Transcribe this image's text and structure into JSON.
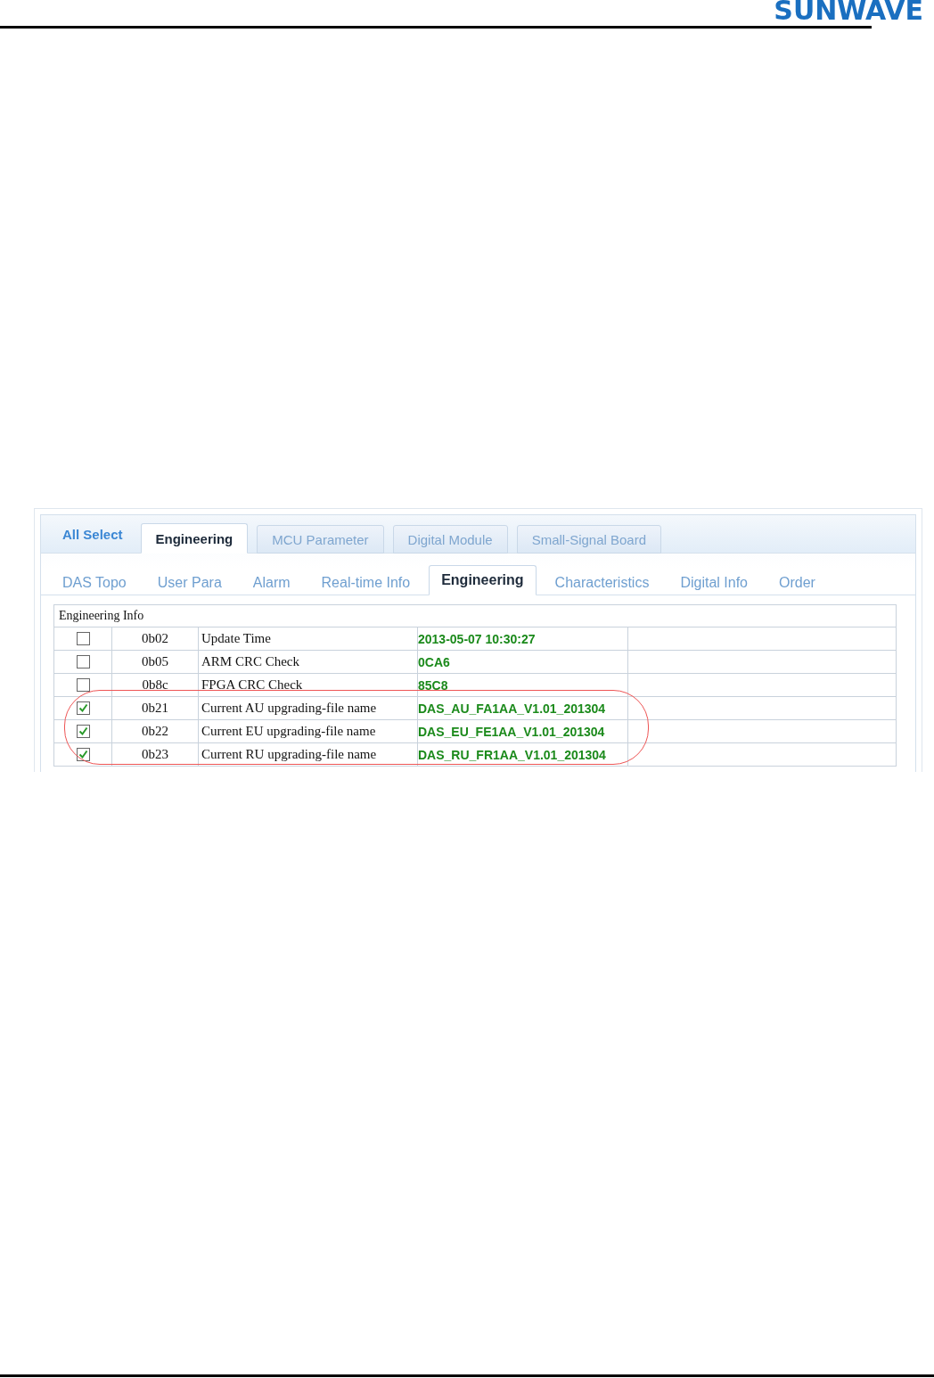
{
  "header": {
    "logo": "SUNWAVE"
  },
  "screenshot": {
    "all_select": "All Select",
    "top_tabs": [
      {
        "label": "Engineering",
        "selected": true
      },
      {
        "label": "MCU Parameter",
        "selected": false
      },
      {
        "label": "Digital Module",
        "selected": false
      },
      {
        "label": "Small-Signal Board",
        "selected": false
      }
    ],
    "sub_tabs": [
      {
        "label": "DAS Topo",
        "selected": false
      },
      {
        "label": "User Para",
        "selected": false
      },
      {
        "label": "Alarm",
        "selected": false
      },
      {
        "label": "Real-time Info",
        "selected": false
      },
      {
        "label": "Engineering",
        "selected": true
      },
      {
        "label": "Characteristics",
        "selected": false
      },
      {
        "label": "Digital Info",
        "selected": false
      },
      {
        "label": "Order",
        "selected": false
      }
    ],
    "table": {
      "title": "Engineering Info",
      "rows": [
        {
          "checked": false,
          "code": "0b02",
          "name": "Update Time",
          "value": "2013-05-07 10:30:27"
        },
        {
          "checked": false,
          "code": "0b05",
          "name": "ARM CRC Check",
          "value": "0CA6"
        },
        {
          "checked": false,
          "code": "0b8c",
          "name": "FPGA CRC Check",
          "value": "85C8"
        },
        {
          "checked": true,
          "code": "0b21",
          "name": "Current AU upgrading-file name",
          "value": "DAS_AU_FA1AA_V1.01_201304"
        },
        {
          "checked": true,
          "code": "0b22",
          "name": "Current EU upgrading-file name",
          "value": "DAS_EU_FE1AA_V1.01_201304"
        },
        {
          "checked": true,
          "code": "0b23",
          "name": "Current RU upgrading-file name",
          "value": "DAS_RU_FR1AA_V1.01_201304"
        }
      ]
    }
  }
}
